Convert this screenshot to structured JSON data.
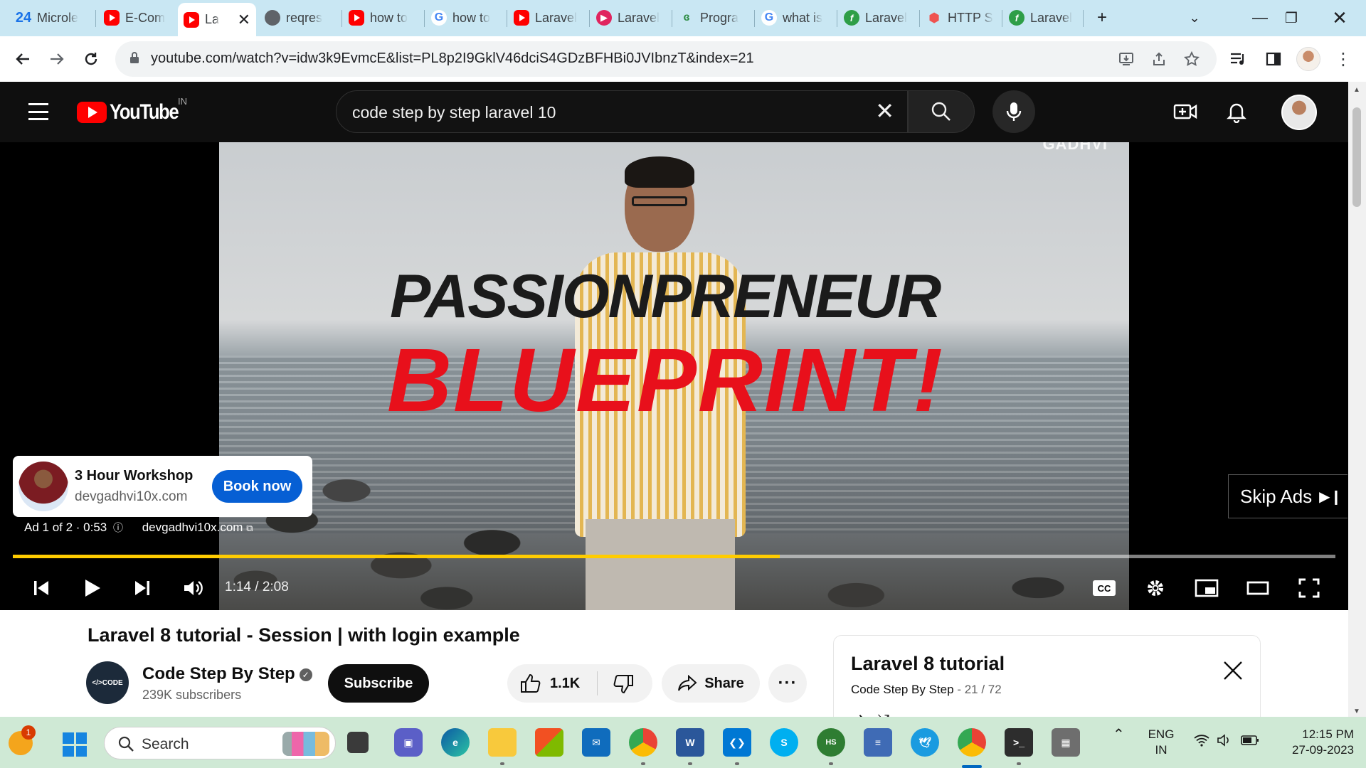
{
  "browser": {
    "tabs": [
      {
        "title": "Microle",
        "icon": "ms-24-icon",
        "prefix": "24"
      },
      {
        "title": "E-Com",
        "icon": "youtube-icon"
      },
      {
        "title": "La",
        "icon": "youtube-icon",
        "active": true
      },
      {
        "title": "reqres",
        "icon": "globe-icon"
      },
      {
        "title": "how to",
        "icon": "youtube-icon"
      },
      {
        "title": "how to",
        "icon": "google-icon"
      },
      {
        "title": "Laravel",
        "icon": "youtube-icon"
      },
      {
        "title": "Laravel",
        "icon": "pink-play-icon"
      },
      {
        "title": "Progra",
        "icon": "gfg-icon"
      },
      {
        "title": "what is",
        "icon": "google-icon"
      },
      {
        "title": "Laravel",
        "icon": "green-f-icon"
      },
      {
        "title": "HTTP S",
        "icon": "laravel-icon"
      },
      {
        "title": "Laravel",
        "icon": "green-f-icon"
      }
    ],
    "url": "youtube.com/watch?v=idw3k9EvmcE&list=PL8p2I9GklV46dciS4GDzBFHBi0JVIbnzT&index=21"
  },
  "youtube": {
    "logo_text": "YouTube",
    "country_code": "IN",
    "search_query": "code step by step laravel 10"
  },
  "player": {
    "headline_line1": "PASSIONPRENEUR",
    "headline_line2": "BLUEPRINT!",
    "watermark": "GADHVI",
    "ad_title": "3 Hour Workshop",
    "ad_domain": "devgadhvi10x.com",
    "ad_button": "Book now",
    "ad_counter": "Ad 1 of 2 · 0:53",
    "ad_link": "devgadhvi10x.com",
    "skip_label": "Skip Ads",
    "time": "1:14 / 2:08",
    "progress_fraction": 0.58
  },
  "video": {
    "title": "Laravel 8 tutorial - Session | with login example",
    "channel_name": "Code Step By Step",
    "subscribers": "239K subscribers",
    "subscribe_label": "Subscribe",
    "likes": "1.1K",
    "share_label": "Share",
    "channel_avatar_text": "</>CODE"
  },
  "playlist": {
    "title": "Laravel 8 tutorial",
    "owner": "Code Step By Step",
    "position": "21 / 72"
  },
  "taskbar": {
    "search_label": "Search",
    "notification_count": "1",
    "lang_line1": "ENG",
    "lang_line2": "IN",
    "time": "12:15 PM",
    "date": "27-09-2023"
  },
  "colors": {
    "youtube_red": "#ff0000",
    "progress_yellow": "#ffcc00",
    "ad_button_blue": "#065fd4",
    "headline_red": "#e8101b",
    "tabstrip_bg": "#c9e7f3",
    "taskbar_bg": "#cfe9d5"
  }
}
